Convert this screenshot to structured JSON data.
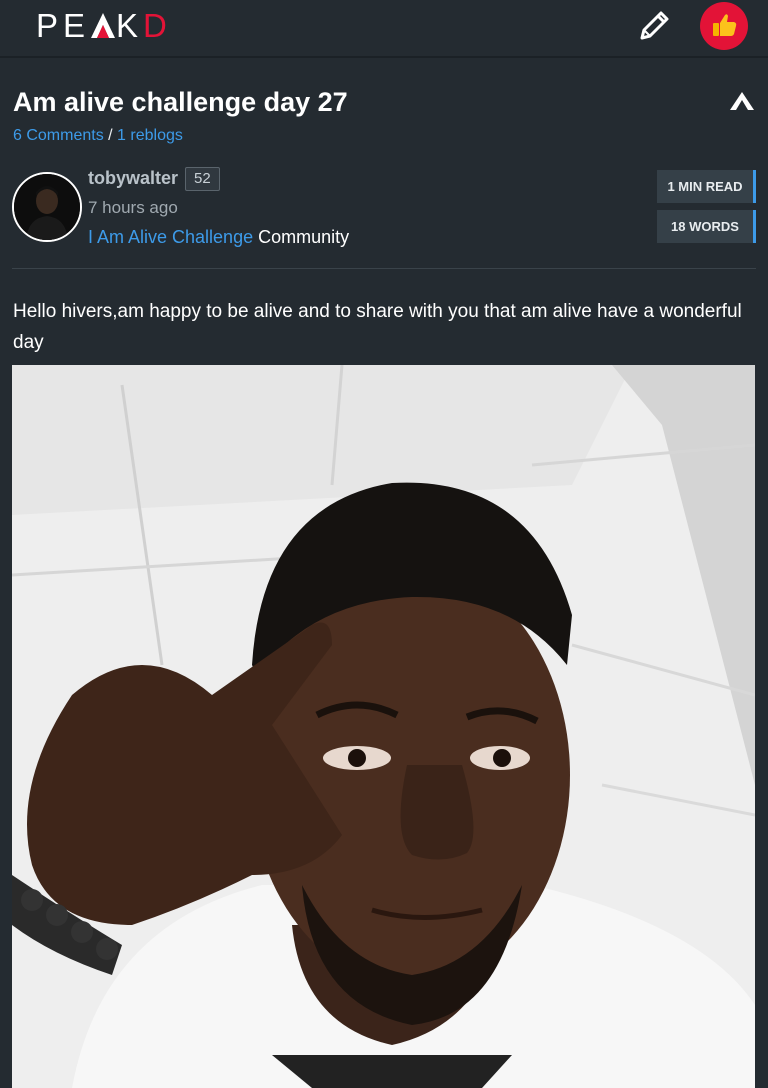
{
  "navbar": {
    "logo_main": "PE",
    "logo_k": "K",
    "logo_d": "D",
    "brand_color": "#e31337",
    "edit_icon": "pencil-icon",
    "vote_icon": "thumbs-up-icon"
  },
  "post": {
    "title": "Am alive challenge day 27",
    "comments": "6 Comments",
    "separator": " / ",
    "reblogs": "1 reblogs",
    "author": "tobywalter",
    "reputation": "52",
    "time_ago": "7 hours ago",
    "community_name": "I Am Alive Challenge",
    "community_suffix": " Community",
    "read_time": "1 MIN READ",
    "word_count": "18 WORDS",
    "body": "Hello hivers,am happy to be alive and to share with you that am alive have a wonderful day"
  },
  "colors": {
    "background": "#242b31",
    "link": "#3d9be9",
    "accent": "#e31337"
  }
}
